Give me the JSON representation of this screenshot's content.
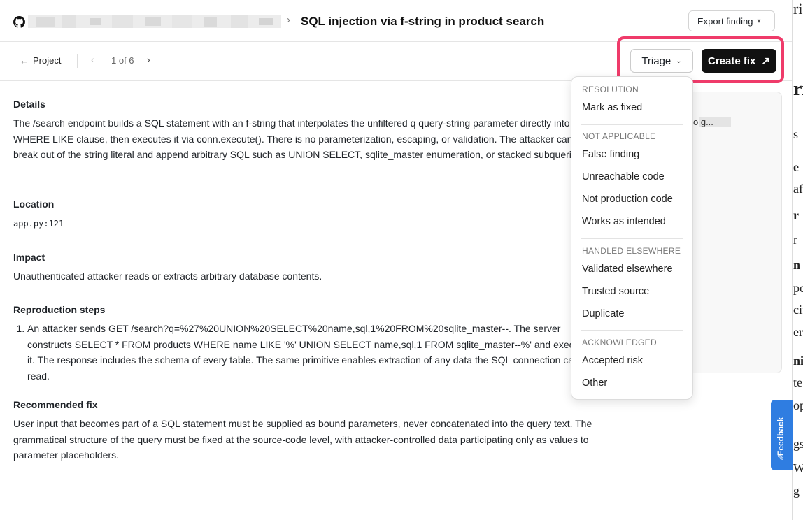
{
  "header": {
    "title": "SQL injection via f-string in product search",
    "export_label": "Export finding",
    "separator": "›"
  },
  "toolbar": {
    "back_label": "Project",
    "pager": "1 of 6",
    "triage_label": "Triage",
    "create_fix_label": "Create fix"
  },
  "details": {
    "heading": "Details",
    "text": "The /search endpoint builds a SQL statement with an f-string that interpolates the unfiltered q query-string parameter directly into the WHERE LIKE clause, then executes it via conn.execute(). There is no parameterization, escaping, or validation. The attacker can break out of the string literal and append arbitrary SQL such as UNION SELECT, sqlite_master enumeration, or stacked subqueries."
  },
  "location": {
    "heading": "Location",
    "value": "app.py:121"
  },
  "impact": {
    "heading": "Impact",
    "text": "Unauthenticated attacker reads or extracts arbitrary database contents."
  },
  "repro": {
    "heading": "Reproduction steps",
    "steps": [
      "An attacker sends GET /search?q=%27%20UNION%20SELECT%20name,sql,1%20FROM%20sqlite_master--. The server constructs SELECT * FROM products WHERE name LIKE '%' UNION SELECT name,sql,1 FROM sqlite_master--%' and executes it. The response includes the schema of every table. The same primitive enables extraction of any data the SQL connection can read."
    ]
  },
  "fix": {
    "heading": "Recommended fix",
    "text": "User input that becomes part of a SQL statement must be supplied as bound parameters, never concatenated into the query text. The grammatical structure of the query must be fixed at the source-code level, with attacker-controlled data participating only as values to parameter placeholders."
  },
  "side": {
    "text": "o g..."
  },
  "menu": {
    "groups": [
      {
        "heading": "RESOLUTION",
        "items": [
          "Mark as fixed"
        ]
      },
      {
        "heading": "NOT APPLICABLE",
        "items": [
          "False finding",
          "Unreachable code",
          "Not production code",
          "Works as intended"
        ]
      },
      {
        "heading": "HANDLED ELSEWHERE",
        "items": [
          "Validated elsewhere",
          "Trusted source",
          "Duplicate"
        ]
      },
      {
        "heading": "ACKNOWLEDGED",
        "items": [
          "Accepted risk",
          "Other"
        ]
      }
    ]
  },
  "feedback_label": "Feedback",
  "right_strip": [
    "ri",
    "s",
    "e",
    "af",
    "r",
    "r",
    "n",
    "pe",
    "cif",
    "er",
    "ni",
    "te",
    "op",
    "gs",
    "W",
    "g"
  ]
}
